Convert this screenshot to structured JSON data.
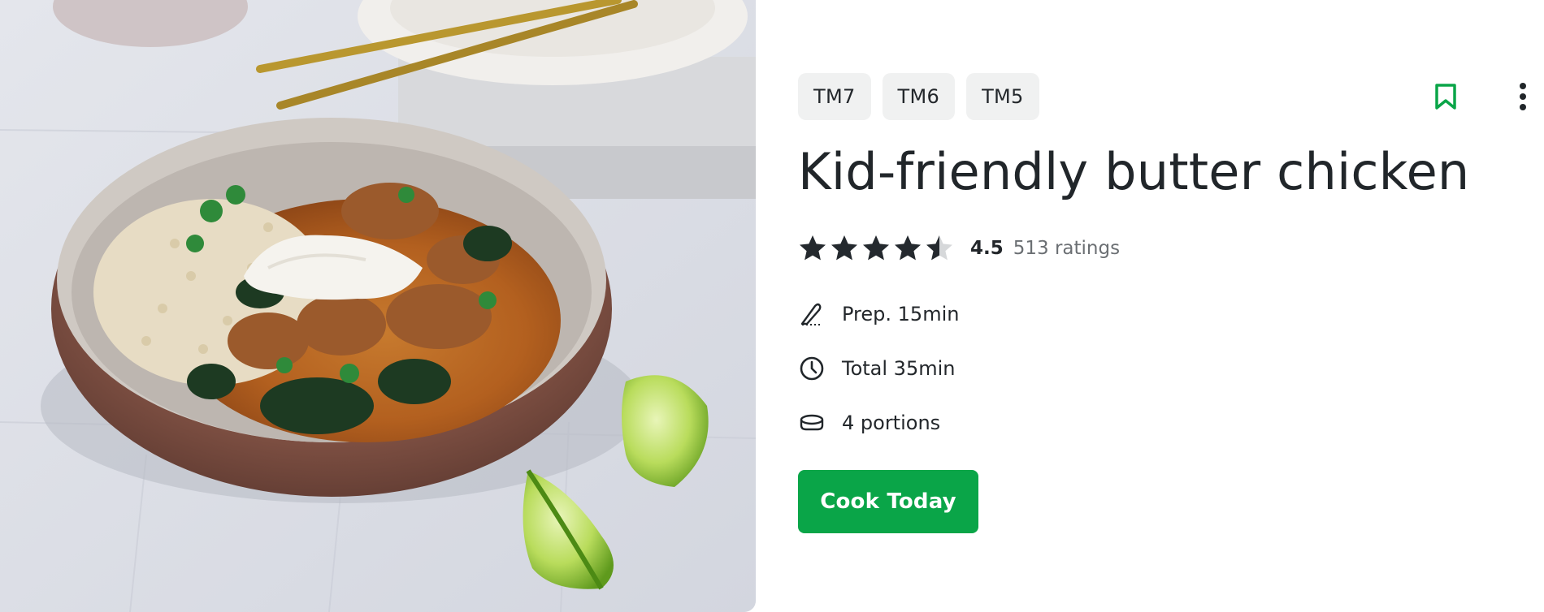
{
  "hero": {
    "image_alt": "Bowl of butter chicken with rice, spinach and a dollop of yoghurt, served with lime wedges"
  },
  "tags": [
    "TM7",
    "TM6",
    "TM5"
  ],
  "recipe": {
    "title": "Kid-friendly butter chicken",
    "rating": {
      "value_label": "4.5",
      "value": 4.5,
      "max": 5,
      "count_label": "513 ratings"
    },
    "prep_label": "Prep. 15min",
    "total_label": "Total 35min",
    "portions_label": "4 portions"
  },
  "actions": {
    "cook_label": "Cook Today"
  },
  "icons": {
    "bookmark": "bookmark-icon",
    "more": "more-vertical-icon",
    "prep": "knife-icon",
    "total": "clock-icon",
    "portions": "bowl-icon"
  },
  "colors": {
    "accent": "#0aa548",
    "star": "#24292e",
    "star_empty": "#d6d8da",
    "tag_bg": "#f0f1f1"
  }
}
